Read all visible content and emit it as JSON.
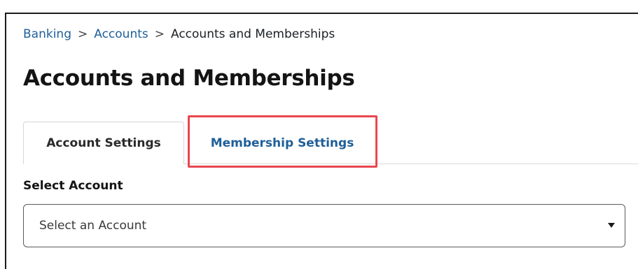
{
  "breadcrumb": {
    "items": [
      "Banking",
      "Accounts",
      "Accounts and Memberships"
    ],
    "separator": ">"
  },
  "page": {
    "title": "Accounts and Memberships"
  },
  "tabs": {
    "account_settings": "Account Settings",
    "membership_settings": "Membership Settings"
  },
  "account_select": {
    "label": "Select Account",
    "placeholder": "Select an Account"
  },
  "colors": {
    "link": "#1f5f99",
    "highlight": "#e8474f",
    "text": "#1a1f24"
  }
}
